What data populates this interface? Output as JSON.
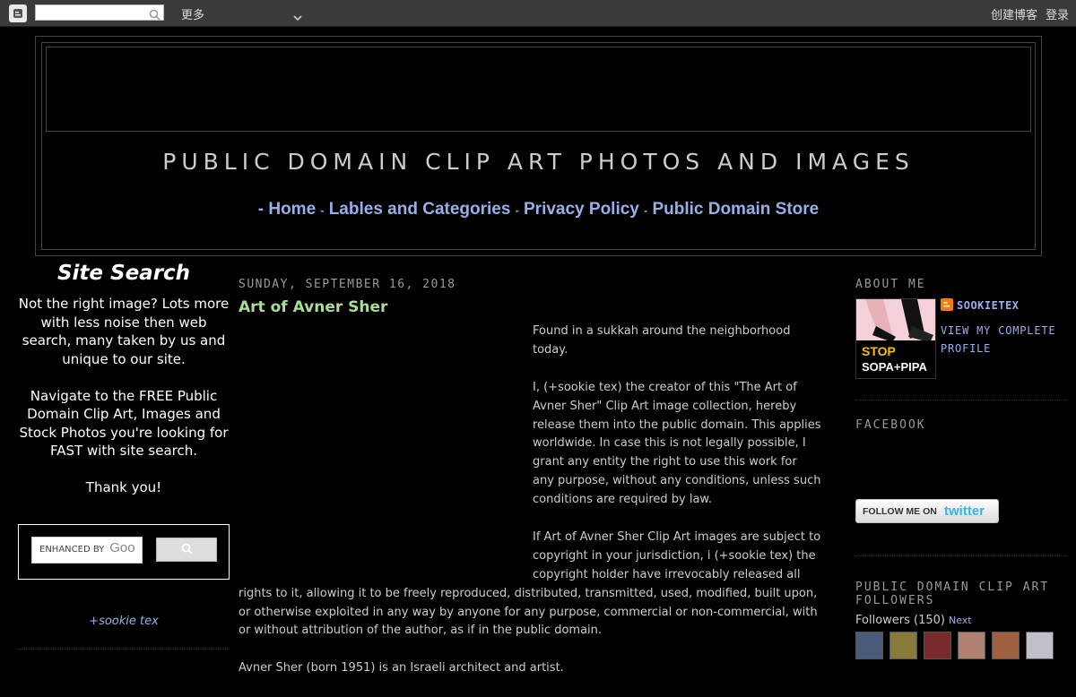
{
  "navbar": {
    "search_placeholder": "",
    "more_label": "更多",
    "create_blog": "创建博客",
    "login": "登录"
  },
  "header": {
    "title": "PUBLIC DOMAIN CLIP ART PHOTOS AND IMAGES",
    "nav_prefix": "-",
    "nav": [
      "Home",
      "Lables and Categories",
      "Privacy Policy",
      "Public Domain Store"
    ],
    "nav_sep": "-"
  },
  "left": {
    "title": "Site Search",
    "para1": "Not the right image? Lots more with less noise then web search, many taken by us and unique to our site.",
    "para2": "Navigate to the FREE Public Domain Clip Art, Images and Stock Photos you're looking for FAST with site search.",
    "para3": "Thank you!",
    "search_label": "ENHANCED BY",
    "search_brand": "Goo",
    "author_link": "+sookie tex"
  },
  "post": {
    "date": "SUNDAY, SEPTEMBER 16, 2018",
    "title": "Art of Avner Sher",
    "p1": "Found in a sukkah around the neighborhood today.",
    "p2": "I, (+sookie tex) the creator of this \"The Art of Avner Sher\" Clip Art image collection, hereby release them into the public domain. This applies worldwide. In case this is not legally possible, I grant any entity the right to use this work for any purpose, without any conditions, unless such conditions are required by law.",
    "p3": "If Art of Avner Sher Clip Art images are subject to copyright in your jurisdiction, i (+sookie tex) the copyright holder have irrevocably released all rights to it, allowing it to be freely reproduced, distributed, transmitted, used, modified, built upon, or otherwise exploited in any way by anyone for any purpose, commercial or non-commercial, with or without attribution of the author, as if in the public domain.",
    "p4": "Avner Sher (born 1951) is an Israeli architect and artist."
  },
  "right": {
    "about_title": "ABOUT ME",
    "profile_name": "SOOKIETEX",
    "view_profile": "VIEW MY COMPLETE PROFILE",
    "profile_stop": "STOP",
    "profile_sopa": "SOPA+PIPA",
    "facebook_title": "FACEBOOK",
    "twitter_follow": "FOLLOW ME ON",
    "twitter_brand": "twitter",
    "followers_title": "PUBLIC DOMAIN CLIP ART FOLLOWERS",
    "followers_label": "Followers (150)",
    "followers_next": "Next",
    "avatar_colors": [
      "#4a5a7a",
      "#8a7a3a",
      "#7a2a2a",
      "#b08070",
      "#a06040",
      "#c0c0c8"
    ]
  },
  "colors": {
    "link": "#9aaee8",
    "post_title": "#aadd99",
    "background": "#000000"
  }
}
